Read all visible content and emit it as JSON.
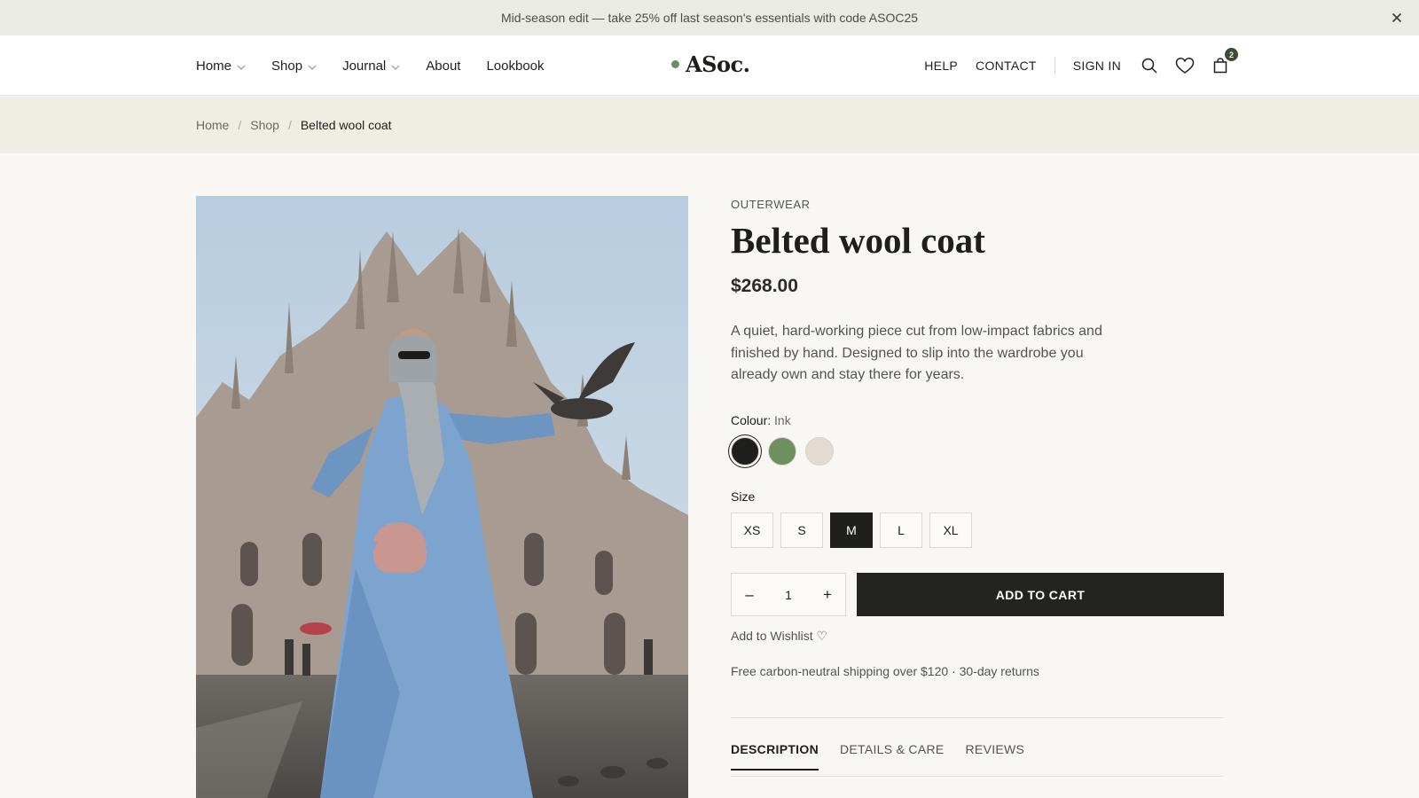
{
  "announcement": {
    "text": "Mid-season edit — take 25% off last season's essentials with code ASOC25",
    "close_icon": "close-icon"
  },
  "header": {
    "nav": [
      {
        "label": "Home",
        "has_dropdown": true
      },
      {
        "label": "Shop",
        "has_dropdown": true
      },
      {
        "label": "Journal",
        "has_dropdown": true
      },
      {
        "label": "About",
        "has_dropdown": false
      },
      {
        "label": "Lookbook",
        "has_dropdown": false
      }
    ],
    "logo": "ASoc.",
    "logo_dot_color": "#6b8f5e",
    "links": {
      "help": "HELP",
      "contact": "CONTACT",
      "sign_in": "SIGN IN"
    },
    "icons": {
      "search": "search-icon",
      "wishlist": "heart-icon",
      "cart": "bag-icon"
    },
    "cart_count": "2"
  },
  "breadcrumb": {
    "items": [
      "Home",
      "Shop"
    ],
    "current": "Belted wool coat",
    "separator": "/"
  },
  "product": {
    "category": "OUTERWEAR",
    "title": "Belted wool coat",
    "price": "$268.00",
    "description": "A quiet, hard-working piece cut from low-impact fabrics and finished by hand. Designed to slip into the wardrobe you already own and stay there for years.",
    "colour_label": "Colour:",
    "colour_value": "Ink",
    "colours": [
      {
        "name": "Ink",
        "hex": "#1f1f1d",
        "selected": true
      },
      {
        "name": "Sage",
        "hex": "#6e8f5e",
        "selected": false
      },
      {
        "name": "Oat",
        "hex": "#e3dad2",
        "selected": false
      }
    ],
    "size_label": "Size",
    "sizes": [
      {
        "label": "XS",
        "selected": false
      },
      {
        "label": "S",
        "selected": false
      },
      {
        "label": "M",
        "selected": true
      },
      {
        "label": "L",
        "selected": false
      },
      {
        "label": "XL",
        "selected": false
      }
    ],
    "quantity": "1",
    "qty_minus": "–",
    "qty_plus": "+",
    "add_to_cart": "ADD TO CART",
    "wishlist": "Add to Wishlist ♡",
    "shipping": "Free carbon-neutral shipping over $120 · 30-day returns",
    "tabs": [
      {
        "label": "DESCRIPTION",
        "active": true
      },
      {
        "label": "DETAILS & CARE",
        "active": false
      },
      {
        "label": "REVIEWS",
        "active": false
      }
    ]
  },
  "colors": {
    "background": "#f8f7f3",
    "announcement_bg": "#eaece4",
    "breadcrumb_bg": "#efeee5",
    "primary_button": "#23231f",
    "text": "#1e1e1b"
  }
}
